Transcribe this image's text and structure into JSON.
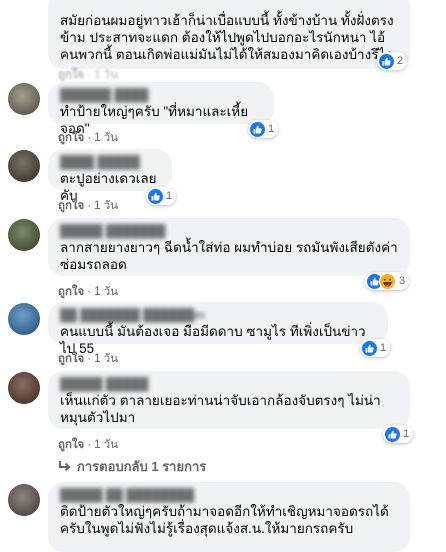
{
  "comments": [
    {
      "name": "",
      "text": "สมัยก่อนผมอยู่ทาวเฮ้าก็น่าเบื่อแบบนี้ ทั้งข้างบ้าน ทั้งฝั่งตรงข้าม ประสาทจะแดก ต้องให้ไปพูดไปบอกอะไรนักหนา ไอ้คนพวกนี้ ตอนเกิดพ่อแม่มันไม่ได้ให้สมองมาคิดเองบ้างรึไง",
      "like": "ถูกใจ",
      "time": "1 วัน",
      "reaction_count": "2"
    },
    {
      "name": "",
      "text": "ทำป้ายใหญ่ๆครับ \"ที่หมาและเหี้ยจอด\"",
      "like": "ถูกใจ",
      "time": "1 วัน",
      "reaction_count": "1"
    },
    {
      "name": "",
      "text": "ตะปูอย่างเดวเลยคับ",
      "like": "ถูกใจ",
      "time": "1 วัน",
      "reaction_count": "1"
    },
    {
      "name": "",
      "text": "ลากสายยางยาวๆ ฉีดน้ำใส่ท่อ ผมทำบ่อย รถมันพังเสียตังค่าซ่อมรถลอด",
      "like": "ถูกใจ",
      "time": "1 วัน",
      "reaction_count": "3"
    },
    {
      "name": "",
      "text": "คนแบบนี้ มันต้องเจอ มือมีดดาบ ซามูไร ทีเพิ่งเป็นข่าวไป 55",
      "like": "ถูกใจ",
      "time": "1 วัน",
      "reaction_count": "1"
    },
    {
      "name": "",
      "text": "เห็นแก่ตัว ตาลายเยอะท่านน่าจับเอากล้องจับตรงๆ ไม่น่าหมุนตัวไปมา",
      "like": "ถูกใจ",
      "time": "1 วัน",
      "reaction_count": "1"
    },
    {
      "name": "",
      "text": "ติดป้ายตัวใหญ่ๆครับถ้ามาจอดอีกให้ทำเชิญหมาจอดรถได้ครับในพูดไม่ฟังไม่รู้เรื่องสุดแจ้งส.น.ให้มายกรถครับ"
    }
  ],
  "replies_label": "การตอบกลับ 1 รายการ",
  "colors": {
    "bubble": "#f0f2f5",
    "meta": "#65676b",
    "like_blue": "#1877f2",
    "haha_yellow": "#f7b125"
  },
  "icons": [
    "like-icon",
    "haha-icon",
    "reply-arrow-icon"
  ]
}
